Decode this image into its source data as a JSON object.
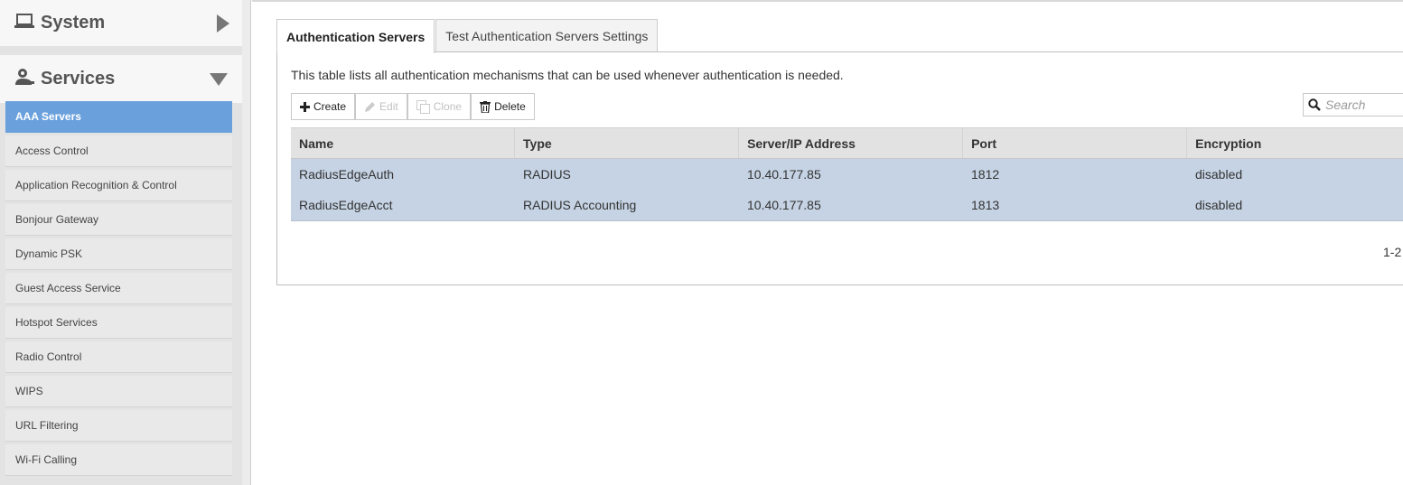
{
  "sidebar": {
    "system_title": "System",
    "services_title": "Services",
    "items": [
      {
        "label": "AAA Servers",
        "active": true
      },
      {
        "label": "Access Control"
      },
      {
        "label": "Application Recognition & Control"
      },
      {
        "label": "Bonjour Gateway"
      },
      {
        "label": "Dynamic PSK"
      },
      {
        "label": "Guest Access Service"
      },
      {
        "label": "Hotspot Services"
      },
      {
        "label": "Radio Control"
      },
      {
        "label": "WIPS"
      },
      {
        "label": "URL Filtering"
      },
      {
        "label": "Wi-Fi Calling"
      }
    ]
  },
  "tabs": [
    {
      "label": "Authentication Servers",
      "active": true
    },
    {
      "label": "Test Authentication Servers Settings"
    }
  ],
  "description": "This table lists all authentication mechanisms that can be used whenever authentication is needed.",
  "toolbar": {
    "create": "Create",
    "edit": "Edit",
    "clone": "Clone",
    "delete": "Delete"
  },
  "search": {
    "placeholder": "Search"
  },
  "table": {
    "columns": [
      "Name",
      "Type",
      "Server/IP Address",
      "Port",
      "Encryption"
    ],
    "rows": [
      [
        "RadiusEdgeAuth",
        "RADIUS",
        "10.40.177.85",
        "1812",
        "disabled"
      ],
      [
        "RadiusEdgeAcct",
        "RADIUS Accounting",
        "10.40.177.85",
        "1813",
        "disabled"
      ]
    ]
  },
  "pager": "1-2",
  "colors": {
    "accent": "#6aa1dc",
    "selected_row": "#c5d3e4"
  },
  "icons": {
    "system": "laptop-icon",
    "services": "services-icon",
    "create": "plus-icon",
    "edit": "pencil-icon",
    "clone": "clone-icon",
    "delete": "trash-icon",
    "search": "search-icon"
  }
}
